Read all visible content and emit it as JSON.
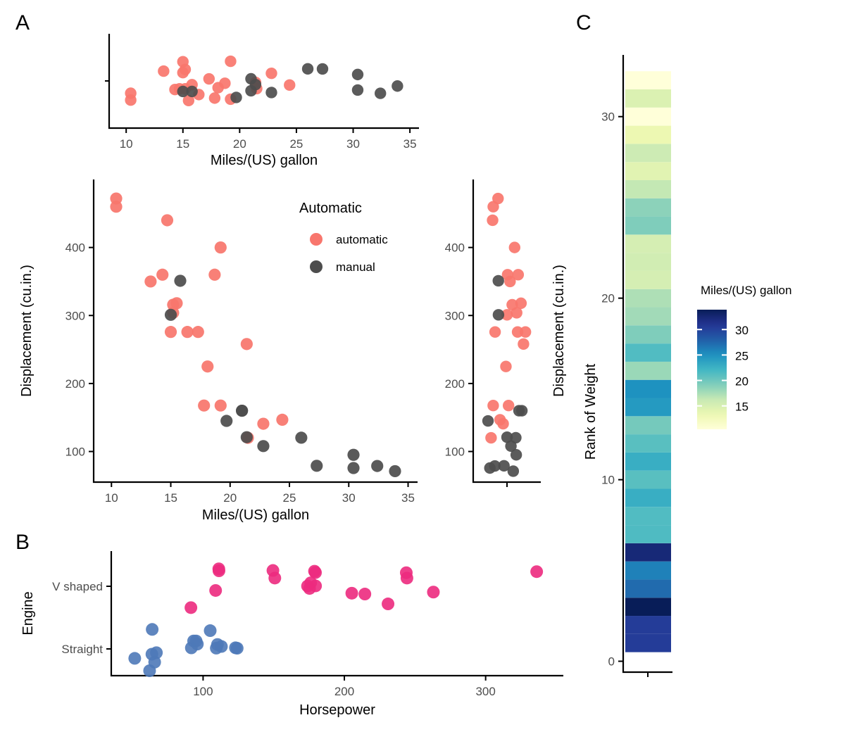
{
  "figure": {
    "panels": [
      {
        "letter": "A"
      },
      {
        "letter": "B"
      },
      {
        "letter": "C"
      }
    ],
    "colors": {
      "automatic": "#F8766D",
      "manual": "#4D4D4D",
      "v_shaped": "#EC2A7E",
      "straight": "#4E79B8",
      "axis": "#000000",
      "tick_text": "#4D4D4D"
    }
  },
  "panelA": {
    "letter": "A",
    "legend": {
      "title": "Automatic",
      "items": [
        {
          "label": "automatic",
          "color": "#F8766D"
        },
        {
          "label": "manual",
          "color": "#4D4D4D"
        }
      ]
    },
    "main": {
      "xlabel": "Miles/(US) gallon",
      "ylabel": "Displacement (cu.in.)",
      "xticks": [
        "10",
        "15",
        "20",
        "25",
        "30",
        "35"
      ],
      "xtick_values": [
        10,
        15,
        20,
        25,
        30,
        35
      ],
      "yticks": [
        "100",
        "200",
        "300",
        "400"
      ],
      "ytick_values": [
        100,
        200,
        300,
        400
      ],
      "xlim": [
        8.5,
        35.8
      ],
      "ylim": [
        55,
        500
      ]
    },
    "top_marginal": {
      "xlabel": "Miles/(US) gallon",
      "xticks": [
        "10",
        "15",
        "20",
        "25",
        "30",
        "35"
      ],
      "xtick_values": [
        10,
        15,
        20,
        25,
        30,
        35
      ],
      "xlim": [
        8.5,
        35.8
      ]
    },
    "right_marginal": {
      "ylabel": "Displacement (cu.in.)",
      "yticks": [
        "100",
        "200",
        "300",
        "400"
      ],
      "ytick_values": [
        100,
        200,
        300,
        400
      ],
      "ylim": [
        55,
        500
      ]
    }
  },
  "panelB": {
    "letter": "B",
    "xlabel": "Horsepower",
    "ylabel": "Engine",
    "xticks": [
      "100",
      "200",
      "300"
    ],
    "xtick_values": [
      100,
      200,
      300
    ],
    "xlim": [
      35,
      355
    ],
    "categories": [
      "V shaped",
      "Straight"
    ]
  },
  "panelC": {
    "letter": "C",
    "ylabel": "Rank of Weight",
    "yticks": [
      "0",
      "10",
      "20",
      "30"
    ],
    "ytick_values": [
      0,
      10,
      20,
      30
    ],
    "ylim": [
      -0.6,
      33.4
    ],
    "colorbar": {
      "title": "Miles/(US) gallon",
      "ticks": [
        "15",
        "20",
        "25",
        "30"
      ],
      "tick_values": [
        15,
        20,
        25,
        30
      ],
      "range": [
        10.4,
        33.9
      ]
    }
  },
  "chart_data": [
    {
      "type": "scatter",
      "name": "panelA-main",
      "title": "",
      "xlabel": "Miles/(US) gallon",
      "ylabel": "Displacement (cu.in.)",
      "xlim": [
        8.5,
        35.8
      ],
      "ylim": [
        55,
        500
      ],
      "grid": false,
      "legend": {
        "title": "Automatic",
        "position": "inside-top-right",
        "entries": [
          "automatic",
          "manual"
        ]
      },
      "series": [
        {
          "name": "automatic",
          "color": "#F8766D",
          "points": [
            {
              "x": 10.4,
              "y": 472
            },
            {
              "x": 10.4,
              "y": 460
            },
            {
              "x": 14.7,
              "y": 440
            },
            {
              "x": 19.2,
              "y": 400
            },
            {
              "x": 18.7,
              "y": 360
            },
            {
              "x": 14.3,
              "y": 360
            },
            {
              "x": 13.3,
              "y": 350
            },
            {
              "x": 15.2,
              "y": 315.8
            },
            {
              "x": 15.5,
              "y": 318
            },
            {
              "x": 15.2,
              "y": 304
            },
            {
              "x": 16.4,
              "y": 275.8
            },
            {
              "x": 17.3,
              "y": 275.8
            },
            {
              "x": 15.0,
              "y": 275.8
            },
            {
              "x": 21.4,
              "y": 258
            },
            {
              "x": 18.1,
              "y": 225
            },
            {
              "x": 17.8,
              "y": 167.6
            },
            {
              "x": 19.2,
              "y": 167.6
            },
            {
              "x": 24.4,
              "y": 146.7
            },
            {
              "x": 22.8,
              "y": 140.8
            },
            {
              "x": 21.5,
              "y": 120.1
            }
          ]
        },
        {
          "name": "manual",
          "color": "#4D4D4D",
          "points": [
            {
              "x": 15.8,
              "y": 351
            },
            {
              "x": 15.0,
              "y": 301
            },
            {
              "x": 21.0,
              "y": 160
            },
            {
              "x": 21.0,
              "y": 160
            },
            {
              "x": 19.7,
              "y": 145
            },
            {
              "x": 21.4,
              "y": 121
            },
            {
              "x": 26.0,
              "y": 120.3
            },
            {
              "x": 22.8,
              "y": 108
            },
            {
              "x": 30.4,
              "y": 95.1
            },
            {
              "x": 27.3,
              "y": 79
            },
            {
              "x": 32.4,
              "y": 78.7
            },
            {
              "x": 30.4,
              "y": 75.7
            },
            {
              "x": 33.9,
              "y": 71.1
            }
          ]
        }
      ]
    },
    {
      "type": "scatter",
      "name": "panelA-top-marginal",
      "xlabel": "Miles/(US) gallon",
      "ylabel": "",
      "xlim": [
        8.5,
        35.8
      ],
      "note": "1D jittered strip plot of mpg, colored by transmission",
      "series": [
        {
          "name": "automatic",
          "color": "#F8766D",
          "values": [
            10.4,
            10.4,
            13.3,
            14.3,
            14.7,
            15.0,
            15.0,
            15.2,
            15.2,
            15.5,
            15.8,
            16.4,
            17.3,
            17.8,
            18.1,
            18.7,
            19.2,
            19.2,
            21.4,
            21.5,
            22.8,
            24.4
          ]
        },
        {
          "name": "manual",
          "color": "#4D4D4D",
          "values": [
            15.0,
            15.8,
            19.7,
            21.0,
            21.0,
            21.4,
            22.8,
            26.0,
            27.3,
            30.4,
            30.4,
            32.4,
            33.9
          ]
        }
      ]
    },
    {
      "type": "scatter",
      "name": "panelA-right-marginal",
      "xlabel": "",
      "ylabel": "Displacement (cu.in.)",
      "ylim": [
        55,
        500
      ],
      "note": "1D jittered strip plot of displacement, colored by transmission",
      "series": [
        {
          "name": "automatic",
          "color": "#F8766D",
          "values": [
            472,
            460,
            440,
            400,
            360,
            360,
            350,
            318,
            315.8,
            304,
            301,
            275.8,
            275.8,
            275.8,
            258,
            225,
            167.6,
            167.6,
            146.7,
            140.8,
            120.1
          ]
        },
        {
          "name": "manual",
          "color": "#4D4D4D",
          "values": [
            351,
            301,
            160,
            160,
            145,
            121,
            120.3,
            108,
            95.1,
            79,
            78.7,
            75.7,
            71.1
          ]
        }
      ]
    },
    {
      "type": "scatter",
      "name": "panelB",
      "xlabel": "Horsepower",
      "ylabel": "Engine",
      "xlim": [
        35,
        355
      ],
      "categories": [
        "V shaped",
        "Straight"
      ],
      "grid": false,
      "note": "jittered categorical strip plot of hp by engine shape (vs)",
      "series": [
        {
          "name": "V shaped",
          "color": "#EC2A7E",
          "values": [
            91,
            110,
            110,
            110,
            150,
            150,
            175,
            175,
            175,
            180,
            180,
            180,
            205,
            215,
            230,
            245,
            245,
            264,
            335
          ]
        },
        {
          "name": "Straight",
          "color": "#4E79B8",
          "values": [
            52,
            62,
            65,
            65,
            66,
            66,
            91,
            93,
            95,
            97,
            105,
            109,
            109,
            113,
            123,
            123
          ]
        }
      ]
    },
    {
      "type": "heatmap",
      "name": "panelC",
      "xlabel": "",
      "ylabel": "Rank of Weight",
      "colorbar_title": "Miles/(US) gallon",
      "colorbar_range": [
        10.4,
        33.9
      ],
      "colorbar_ticks": [
        15,
        20,
        25,
        30
      ],
      "palette": "YlGnBu",
      "ylim": [
        -0.6,
        33.4
      ],
      "note": "One column, 32 cells; y = rank of weight (1 = lightest at bottom), fill = mpg",
      "cells": [
        {
          "rank": 1,
          "mpg": 30.4
        },
        {
          "rank": 2,
          "mpg": 30.4
        },
        {
          "rank": 3,
          "mpg": 33.9
        },
        {
          "rank": 4,
          "mpg": 27.3
        },
        {
          "rank": 5,
          "mpg": 26.0
        },
        {
          "rank": 6,
          "mpg": 32.4
        },
        {
          "rank": 7,
          "mpg": 21.5
        },
        {
          "rank": 8,
          "mpg": 21.4
        },
        {
          "rank": 9,
          "mpg": 22.8
        },
        {
          "rank": 10,
          "mpg": 21.0
        },
        {
          "rank": 11,
          "mpg": 22.8
        },
        {
          "rank": 12,
          "mpg": 21.0
        },
        {
          "rank": 13,
          "mpg": 19.7
        },
        {
          "rank": 14,
          "mpg": 24.4
        },
        {
          "rank": 15,
          "mpg": 25.0
        },
        {
          "rank": 16,
          "mpg": 18.1
        },
        {
          "rank": 17,
          "mpg": 21.4
        },
        {
          "rank": 18,
          "mpg": 19.2
        },
        {
          "rank": 19,
          "mpg": 17.8
        },
        {
          "rank": 20,
          "mpg": 17.3
        },
        {
          "rank": 21,
          "mpg": 15.2
        },
        {
          "rank": 22,
          "mpg": 15.5
        },
        {
          "rank": 23,
          "mpg": 15.2
        },
        {
          "rank": 24,
          "mpg": 19.2
        },
        {
          "rank": 25,
          "mpg": 18.7
        },
        {
          "rank": 26,
          "mpg": 16.4
        },
        {
          "rank": 27,
          "mpg": 14.3
        },
        {
          "rank": 28,
          "mpg": 15.8
        },
        {
          "rank": 29,
          "mpg": 13.3
        },
        {
          "rank": 30,
          "mpg": 10.4
        },
        {
          "rank": 31,
          "mpg": 14.7
        },
        {
          "rank": 32,
          "mpg": 10.4
        }
      ]
    }
  ]
}
